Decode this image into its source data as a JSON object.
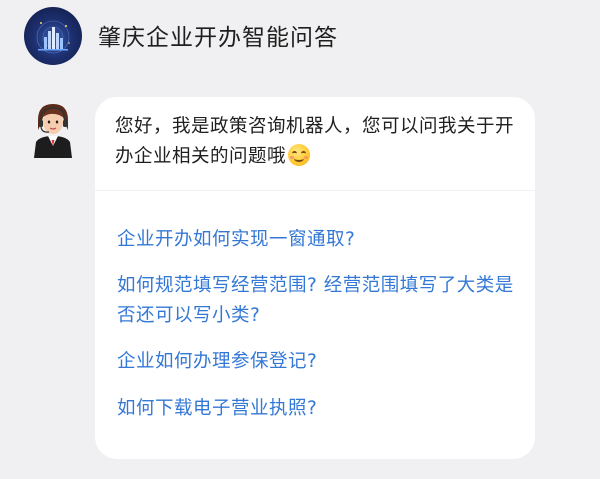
{
  "header": {
    "title": "肇庆企业开办智能问答",
    "logo_icon": "city-logo-icon"
  },
  "bot": {
    "avatar_icon": "customer-service-agent-icon",
    "greeting": "您好，我是政策咨询机器人，您可以问我关于开办企业相关的问题哦",
    "emoji_icon": "smiling-face-icon"
  },
  "questions": [
    {
      "text": "企业开办如何实现一窗通取?"
    },
    {
      "text": "如何规范填写经营范围? 经营范围填写了大类是否还可以写小类?"
    },
    {
      "text": "企业如何办理参保登记?"
    },
    {
      "text": "如何下载电子营业执照?"
    }
  ],
  "colors": {
    "background": "#f0f0f2",
    "bubble": "#ffffff",
    "link": "#3478d6",
    "text": "#1f1f1f"
  }
}
